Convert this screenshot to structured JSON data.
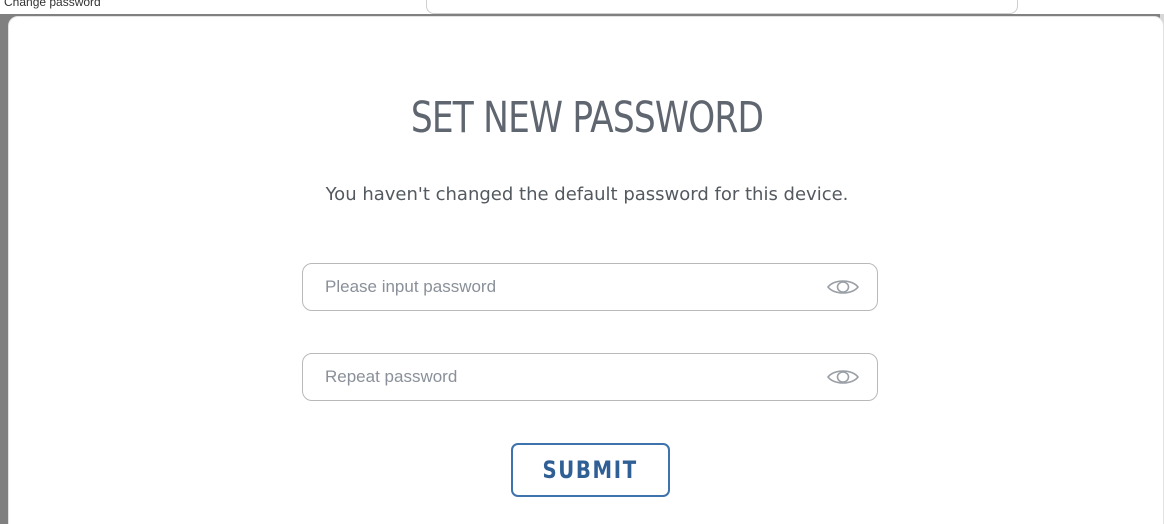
{
  "background": {
    "top_text": "Change password"
  },
  "dialog": {
    "title": "SET NEW PASSWORD",
    "message": "You haven't changed the default password for this device.",
    "password_field": {
      "placeholder": "Please input password",
      "value": "",
      "icon": "eye-icon"
    },
    "repeat_field": {
      "placeholder": "Repeat password",
      "value": "",
      "icon": "eye-icon"
    },
    "submit_label": "SUBMIT"
  },
  "colors": {
    "accent": "#3f73ad",
    "title": "#5f6670",
    "text": "#53595f",
    "placeholder": "#8a9099",
    "border": "#b9b9b9"
  }
}
